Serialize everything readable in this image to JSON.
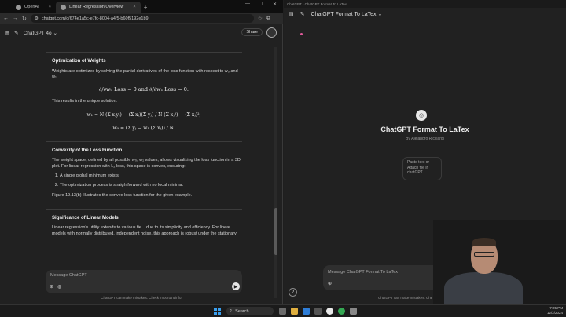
{
  "browser": {
    "tabs": [
      {
        "label": "OpenAI"
      },
      {
        "label": "Linear Regression Overview",
        "active": true
      }
    ],
    "url": "chatgpt.com/c/674e1a5c-e7fc-8004-a4f5-b60f5192e1b9"
  },
  "left": {
    "model": "ChatGPT 4o",
    "share_label": "Share",
    "sections": {
      "opt_title": "Optimization of Weights",
      "opt_text": "Weights are optimized by solving the partial derivatives of the loss function with respect to w₀ and w₁:",
      "eq1": "∂/∂w₀ Loss = 0   and   ∂/∂w₁ Loss = 0.",
      "solution_text": "This results in the unique solution:",
      "eq2": "w₁ = N (Σ xⱼyⱼ) − (Σ xⱼ)(Σ yⱼ)  /  N (Σ xⱼ²) − (Σ xⱼ)²,",
      "eq3": "w₀ = (Σ yⱼ − w₁ (Σ xⱼ)) / N.",
      "convex_title": "Convexity of the Loss Function",
      "convex_text": "The weight space, defined by all possible w₀, w₁ values, allows visualizing the loss function in a 3D plot. For linear regression with L₂ loss, this space is convex, ensuring:",
      "list": [
        "A single global minimum exists.",
        "The optimization process is straightforward with no local minima."
      ],
      "figure_text": "Figure 19.13(b) illustrates the convex loss function for the given example.",
      "sig_title": "Significance of Linear Models",
      "sig_text": "Linear regression's utility extends to various fie... due to its simplicity and efficiency. For linear models with normally distributed, independent noise, this approach is robust under the stationary"
    },
    "composer_placeholder": "Message ChatGPT",
    "disclaimer": "ChatGPT can make mistakes. Check important info."
  },
  "right": {
    "window_title": "ChatGPT - ChatGPT Format To LaTex",
    "gpt_title": "ChatGPT Format To LaTex",
    "gpt_name": "ChatGPT Format To LaTex",
    "author": "By Alejandro Ricciardi",
    "starter": "Paste text or Attach file in chatGPT...",
    "composer_placeholder": "Message ChatGPT Format To LaTex",
    "disclaimer": "ChatGPT can make mistakes. Che"
  },
  "taskbar": {
    "search": "Search",
    "time": "7:25 PM",
    "date": "12/2/2024"
  },
  "colors": {
    "accent": "#3aa0f0",
    "pink_dot": "#e05a9a"
  }
}
